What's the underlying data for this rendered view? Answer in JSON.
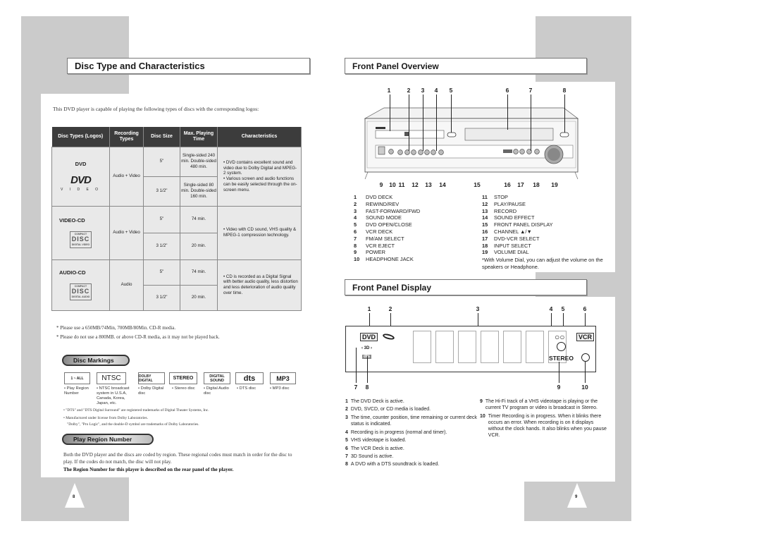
{
  "left_page": {
    "section_title": "Disc Type and Characteristics",
    "intro": "This DVD player is capable of playing the following types of discs with the corresponding logos:",
    "table": {
      "headers": [
        "Disc Types (Logos)",
        "Recording Types",
        "Disc Size",
        "Max. Playing Time",
        "Characteristics"
      ],
      "rows": [
        {
          "disc_type": "DVD",
          "logo": "DVD VIDEO",
          "logo_sub": "V I D E O",
          "recording": "Audio + Video",
          "sizes": [
            {
              "size": "5\"",
              "time": "Single-sided 240 min. Double-sided 480 min."
            },
            {
              "size": "3 1/2\"",
              "time": "Single-sided 80 min. Double-sided 160 min."
            }
          ],
          "characteristics": [
            "DVD contains excellent sound and video due to Dolby Digital and MPEG-2 system.",
            "Various screen and audio functions can be easily selected through the on-screen menu."
          ]
        },
        {
          "disc_type": "VIDEO-CD",
          "logo": "DISC",
          "logo_top": "COMPACT",
          "logo_sub": "DIGITAL VIDEO",
          "recording": "Audio + Video",
          "sizes": [
            {
              "size": "5\"",
              "time": "74 min."
            },
            {
              "size": "3 1/2\"",
              "time": "20 min."
            }
          ],
          "characteristics": [
            "Video with CD sound, VHS quality & MPEG-1 compression technology."
          ]
        },
        {
          "disc_type": "AUDIO-CD",
          "logo": "DISC",
          "logo_top": "COMPACT",
          "logo_sub": "DIGITAL AUDIO",
          "recording": "Audio",
          "sizes": [
            {
              "size": "5\"",
              "time": "74 min."
            },
            {
              "size": "3 1/2\"",
              "time": "20 min."
            }
          ],
          "characteristics": [
            "CD is recorded as a Digital Signal with better audio quality, less distortion and less deterioration of audio quality over time."
          ]
        }
      ]
    },
    "notes": [
      "* Please use a 650MB/74Min, 700MB/80Min. CD-R media.",
      "* Please do not use a 800MB. or above CD-R media, as it may not be played back."
    ],
    "disc_markings": {
      "title": "Disc Markings",
      "items": [
        {
          "logo": "1 ~ ALL",
          "label": "• Play Region Number"
        },
        {
          "logo": "NTSC",
          "label": "• NTSC broadcast system in U.S.A, Canada, Korea, Japan, etc."
        },
        {
          "logo": "DOLBY DIGITAL",
          "label": "• Dolby Digital disc"
        },
        {
          "logo": "STEREO",
          "label": "• Stereo disc"
        },
        {
          "logo": "DIGITAL SOUND",
          "label": "• Digital Audio disc"
        },
        {
          "logo": "dts",
          "label": "• DTS disc"
        },
        {
          "logo": "MP3",
          "label": "• MP3 disc"
        }
      ],
      "legal": [
        "• \"DTS\" and \"DTS Digital Surround\" are registered trademarks of Digital Theater Systems, Inc.",
        "• Manufactured under license from Dolby Laboratories.",
        "\"Dolby\", \"Pro Logic\", and the double-D symbol are trademarks of Dolby Laboratories."
      ]
    },
    "play_region": {
      "title": "Play Region Number",
      "text": "Both the DVD player and the discs are coded by region. These regional codes must match in order for the disc to play. If the codes do not match, the disc will not play.",
      "bold_text": "The Region Number for this player is described on the rear panel of the player."
    },
    "page_number": "8"
  },
  "right_page": {
    "front_panel_overview": {
      "title": "Front Panel Overview",
      "top_callouts": [
        "1",
        "2",
        "3",
        "4",
        "5",
        "6",
        "7",
        "8"
      ],
      "bottom_callouts": [
        "9",
        "10",
        "11",
        "12",
        "13",
        "14",
        "15",
        "16",
        "17",
        "18",
        "19"
      ],
      "legend_left": [
        {
          "n": "1",
          "label": "DVD DECK"
        },
        {
          "n": "2",
          "label": "REWIND/REV"
        },
        {
          "n": "3",
          "label": "FAST-FORWARD/FWD"
        },
        {
          "n": "4",
          "label": "SOUND MODE"
        },
        {
          "n": "5",
          "label": "DVD OPEN/CLOSE"
        },
        {
          "n": "6",
          "label": "VCR DECK"
        },
        {
          "n": "7",
          "label": "FM/AM SELECT"
        },
        {
          "n": "8",
          "label": "VCR EJECT"
        },
        {
          "n": "9",
          "label": "POWER"
        },
        {
          "n": "10",
          "label": "HEADPHONE JACK"
        }
      ],
      "legend_right": [
        {
          "n": "11",
          "label": "STOP"
        },
        {
          "n": "12",
          "label": "PLAY/PAUSE"
        },
        {
          "n": "13",
          "label": "RECORD"
        },
        {
          "n": "14",
          "label": "SOUND EFFECT"
        },
        {
          "n": "15",
          "label": "FRONT PANEL DISPLAY"
        },
        {
          "n": "16",
          "label": "CHANNEL ▲/▼"
        },
        {
          "n": "17",
          "label": "DVD-VCR SELECT"
        },
        {
          "n": "18",
          "label": "INPUT SELECT"
        },
        {
          "n": "19",
          "label": "VOLUME DIAL"
        }
      ],
      "volume_note": "*With Volume Dial, you can adjust the volume on the speakers or Headphone."
    },
    "front_panel_display": {
      "title": "Front Panel Display",
      "top_callouts": [
        "1",
        "2",
        "3",
        "4",
        "5",
        "6"
      ],
      "bottom_callouts": [
        "7",
        "8",
        "9",
        "10"
      ],
      "indicators": {
        "dvd": "DVD",
        "vcr": "VCR",
        "stereo": "STEREO",
        "sound3d": "3D",
        "dts": "dts"
      },
      "descriptions_left": [
        {
          "n": "1",
          "text": "The DVD Deck is active."
        },
        {
          "n": "2",
          "text": "DVD, SVCD, or CD media is loaded."
        },
        {
          "n": "3",
          "text": "The time, counter position, time remaining or current deck status is indicated."
        },
        {
          "n": "4",
          "text": "Recording is in progress (normal and timer)."
        },
        {
          "n": "5",
          "text": "VHS videotape is loaded."
        },
        {
          "n": "6",
          "text": "The VCR Deck is active."
        },
        {
          "n": "7",
          "text": "3D Sound is active."
        },
        {
          "n": "8",
          "text": "A DVD with a DTS soundtrack is loaded."
        }
      ],
      "descriptions_right": [
        {
          "n": "9",
          "text": "The Hi-Fi track of a VHS videotape is playing or the current TV program or video is broadcast in Stereo."
        },
        {
          "n": "10",
          "text": "Timer Recording is in progress. When it blinks there occurs an error. When recording is on it displays without the clock hands. It also blinks when you pause VCR."
        }
      ]
    },
    "page_number": "9"
  }
}
